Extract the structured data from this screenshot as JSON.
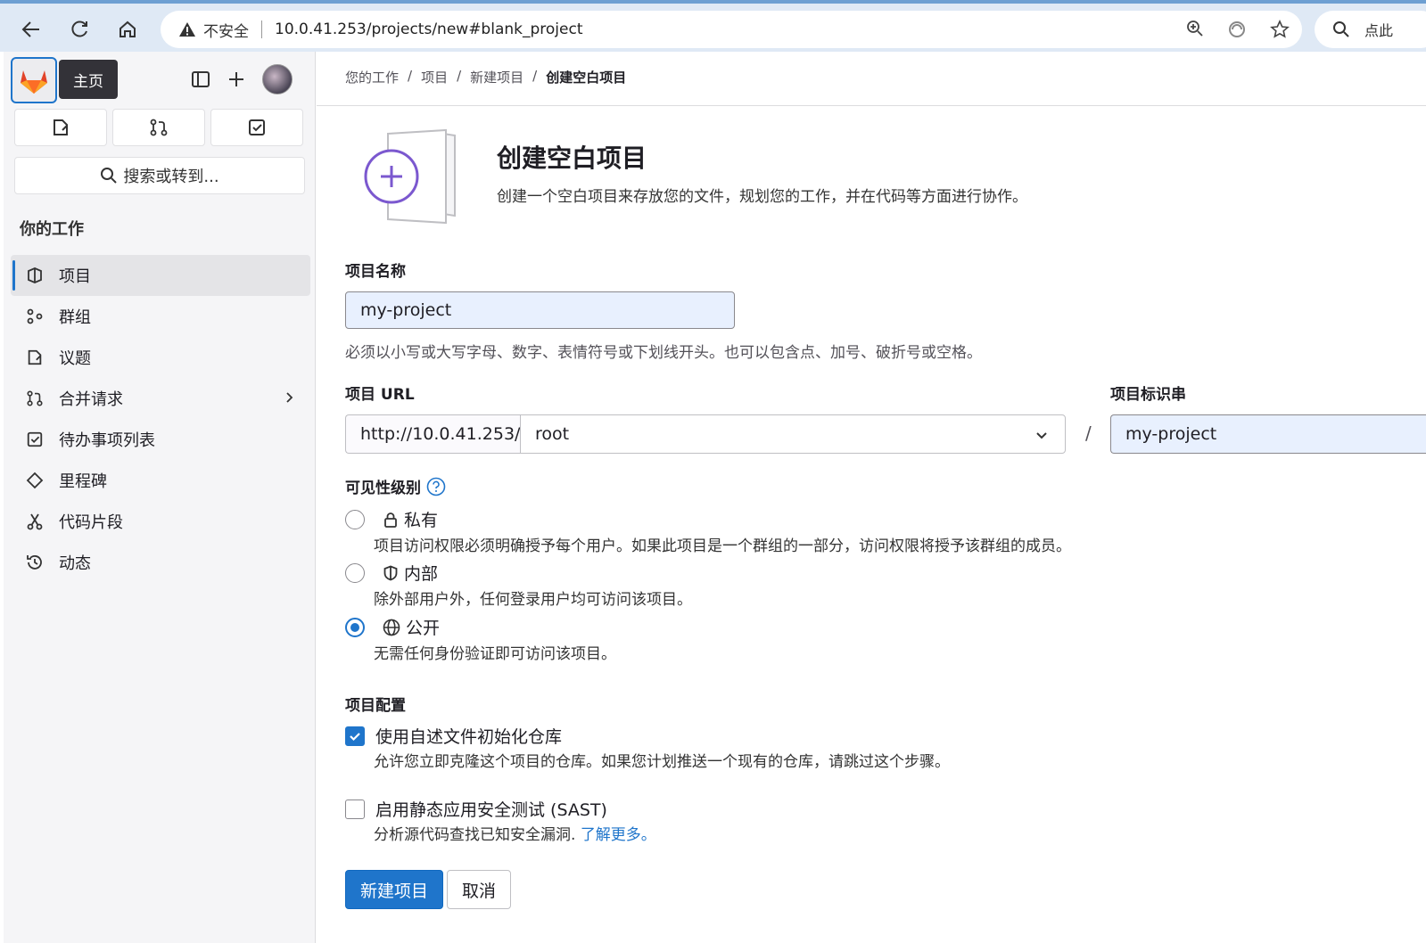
{
  "browser": {
    "security_label": "不安全",
    "url": "10.0.41.253/projects/new#blank_project",
    "search_placeholder": "点此"
  },
  "sidebar": {
    "tooltip": "主页",
    "search_label": "搜索或转到...",
    "section_title": "你的工作",
    "items": [
      {
        "label": "项目",
        "icon": "project-icon",
        "active": true
      },
      {
        "label": "群组",
        "icon": "group-icon"
      },
      {
        "label": "议题",
        "icon": "issue-icon"
      },
      {
        "label": "合并请求",
        "icon": "merge-request-icon"
      },
      {
        "label": "待办事项列表",
        "icon": "todo-icon"
      },
      {
        "label": "里程碑",
        "icon": "milestone-icon"
      },
      {
        "label": "代码片段",
        "icon": "snippet-icon"
      },
      {
        "label": "动态",
        "icon": "activity-icon"
      }
    ]
  },
  "breadcrumb": [
    "您的工作",
    "项目",
    "新建项目",
    "创建空白项目"
  ],
  "header": {
    "title": "创建空白项目",
    "description": "创建一个空白项目来存放您的文件，规划您的工作，并在代码等方面进行协作。"
  },
  "form": {
    "name_label": "项目名称",
    "name_value": "my-project",
    "name_hint": "必须以小写或大写字母、数字、表情符号或下划线开头。也可以包含点、加号、破折号或空格。",
    "url_label": "项目 URL",
    "url_prefix": "http://10.0.41.253/",
    "namespace": "root",
    "slash": "/",
    "slug_label": "项目标识串",
    "slug_value": "my-project",
    "visibility_label": "可见性级别",
    "visibility": [
      {
        "label": "私有",
        "desc": "项目访问权限必须明确授予每个用户。如果此项目是一个群组的一部分，访问权限将授予该群组的成员。",
        "checked": false,
        "icon": "lock-icon"
      },
      {
        "label": "内部",
        "desc": "除外部用户外，任何登录用户均可访问该项目。",
        "checked": false,
        "icon": "shield-icon"
      },
      {
        "label": "公开",
        "desc": "无需任何身份验证即可访问该项目。",
        "checked": true,
        "icon": "globe-icon"
      }
    ],
    "config_label": "项目配置",
    "readme_label": "使用自述文件初始化仓库",
    "readme_desc": "允许您立即克隆这个项目的仓库。如果您计划推送一个现有的仓库，请跳过这个步骤。",
    "readme_checked": true,
    "sast_label": "启用静态应用安全测试 (SAST)",
    "sast_desc": "分析源代码查找已知安全漏洞.",
    "sast_link": "了解更多。",
    "sast_checked": false,
    "submit_label": "新建项目",
    "cancel_label": "取消"
  }
}
